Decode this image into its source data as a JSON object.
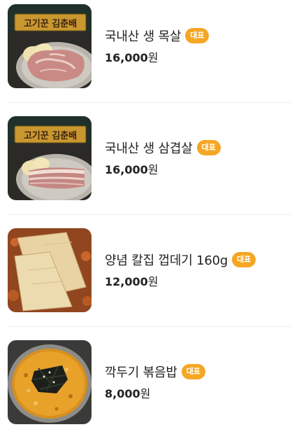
{
  "menu": {
    "badge_label": "대표",
    "currency_unit": "원",
    "items": [
      {
        "name": "국내산 생 목살",
        "price": "16,000",
        "image": "pork-neck-on-tray",
        "sign_text": "고기꾼 김춘배"
      },
      {
        "name": "국내산 생 삼겹살",
        "price": "16,000",
        "image": "pork-belly-on-tray",
        "sign_text": "고기꾼 김춘배"
      },
      {
        "name": "양념 칼집 껍데기 160g",
        "price": "12,000",
        "image": "seasoned-pork-skin-sheets"
      },
      {
        "name": "깍두기 볶음밥",
        "price": "8,000",
        "image": "kkakdugi-fried-rice-pan"
      }
    ]
  },
  "colors": {
    "badge": "#f5a623",
    "divider": "#eeeeee",
    "text": "#222222"
  }
}
